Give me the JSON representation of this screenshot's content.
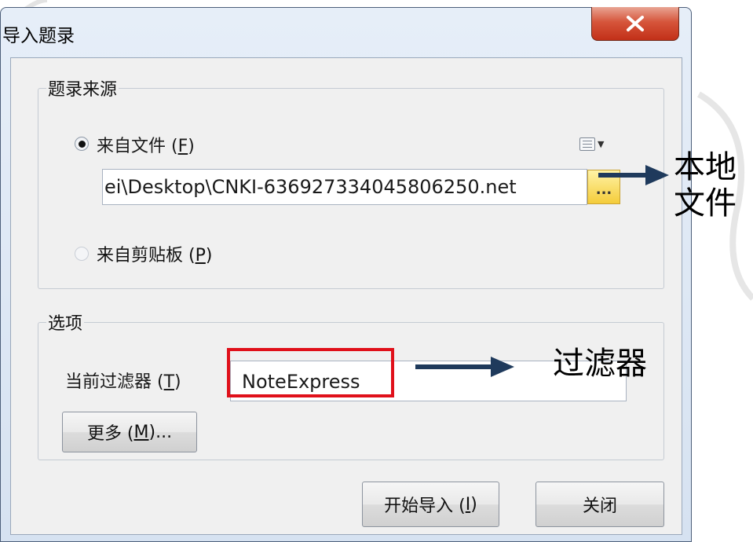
{
  "window": {
    "title": "导入题录",
    "close_glyph": "X"
  },
  "source_group": {
    "label": "题录来源",
    "from_file": {
      "label": "来自文件 (",
      "key": "F",
      "suffix": ")",
      "checked": true
    },
    "file_path": "ei\\Desktop\\CNKI-636927334045806250.net",
    "browse_label": "...",
    "from_clipboard": {
      "label": "来自剪贴板 (",
      "key": "P",
      "suffix": ")",
      "checked": false
    }
  },
  "options_group": {
    "label": "选项",
    "filter_label": {
      "text": "当前过滤器 (",
      "key": "T",
      "suffix": ")"
    },
    "filter_value": "NoteExpress",
    "more_button": {
      "text": "更多 (",
      "key": "M",
      "suffix": ")..."
    }
  },
  "footer": {
    "start_button": {
      "text": "开始导入 (",
      "key": "I",
      "suffix": ")"
    },
    "close_button": "关闭"
  },
  "annotations": {
    "local_file_line1": "本地",
    "local_file_line2": "文件",
    "filter": "过滤器",
    "arrow_color": "#1f3a5c",
    "highlight_color": "#e0101a"
  }
}
